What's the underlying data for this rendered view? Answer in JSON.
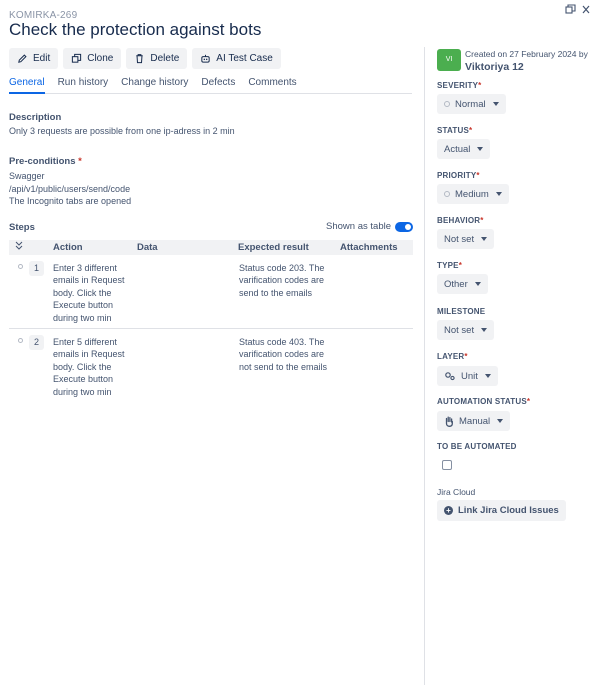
{
  "header": {
    "case_key": "KOMIRKA-269",
    "title": "Check the protection against bots"
  },
  "toolbar": {
    "edit": "Edit",
    "clone": "Clone",
    "delete": "Delete",
    "ai_test_case": "AI Test Case"
  },
  "tabs": [
    "General",
    "Run history",
    "Change history",
    "Defects",
    "Comments"
  ],
  "active_tab": "General",
  "description": {
    "label": "Description",
    "text": "Only 3 requests are possible from one ip-adress in 2 min"
  },
  "preconditions": {
    "label": "Pre-conditions",
    "required_mark": "*",
    "lines": [
      "Swagger",
      "/api/v1/public/users/send/code",
      "The Incognito tabs are opened"
    ]
  },
  "steps": {
    "label": "Steps",
    "toggle_label": "Shown as table",
    "toggle_on": true,
    "columns": {
      "action": "Action",
      "data": "Data",
      "expected": "Expected result",
      "attachments": "Attachments"
    },
    "rows": [
      {
        "num": "1",
        "action": "Enter 3 different emails in Request body. Click the Execute button during two min",
        "data": "",
        "expected": "Status code 203. The varification codes are send to the emails"
      },
      {
        "num": "2",
        "action": "Enter 5 different emails in Request body. Click the Execute button during two min",
        "data": "",
        "expected": "Status code 403. The varification codes are not send to the emails"
      }
    ]
  },
  "sidebar": {
    "avatar_initials": "VI",
    "created": "Created on 27 February 2024 by",
    "author": "Viktoriya 12",
    "fields": {
      "severity": {
        "label": "SEVERITY",
        "required": "*",
        "value": "Normal"
      },
      "status": {
        "label": "STATUS",
        "required": "*",
        "value": "Actual"
      },
      "priority": {
        "label": "PRIORITY",
        "required": "*",
        "value": "Medium"
      },
      "behavior": {
        "label": "BEHAVIOR",
        "required": "*",
        "value": "Not set"
      },
      "type": {
        "label": "TYPE",
        "required": "*",
        "value": "Other"
      },
      "milestone": {
        "label": "MILESTONE",
        "required": "",
        "value": "Not set"
      },
      "layer": {
        "label": "LAYER",
        "required": "*",
        "value": "Unit"
      },
      "automation_status": {
        "label": "AUTOMATION STATUS",
        "required": "*",
        "value": "Manual"
      },
      "to_be_automated": {
        "label": "TO BE AUTOMATED",
        "checked": false
      }
    },
    "jira": {
      "label": "Jira Cloud",
      "button": "Link Jira Cloud Issues"
    }
  },
  "colors": {
    "accent": "#0c66e4",
    "avatar": "#4bae4f",
    "required": "#c9372c"
  }
}
